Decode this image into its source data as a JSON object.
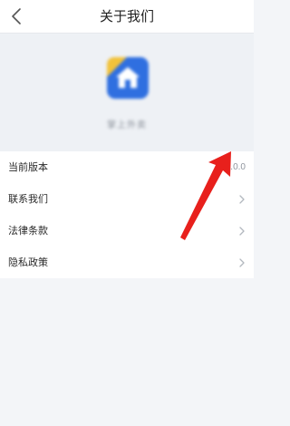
{
  "header": {
    "title": "关于我们",
    "back_icon": "chevron-left-icon"
  },
  "app": {
    "icon": "app-logo-icon",
    "name": "掌上外卖",
    "accent": "#2f6fe0"
  },
  "menu": {
    "items": [
      {
        "label": "当前版本",
        "value": "3.0.0"
      },
      {
        "label": "联系我们",
        "chevron": "chevron-right-icon"
      },
      {
        "label": "法律条款",
        "chevron": "chevron-right-icon"
      },
      {
        "label": "隐私政策",
        "chevron": "chevron-right-icon"
      }
    ]
  },
  "annotation": {
    "color": "#e8201c"
  }
}
